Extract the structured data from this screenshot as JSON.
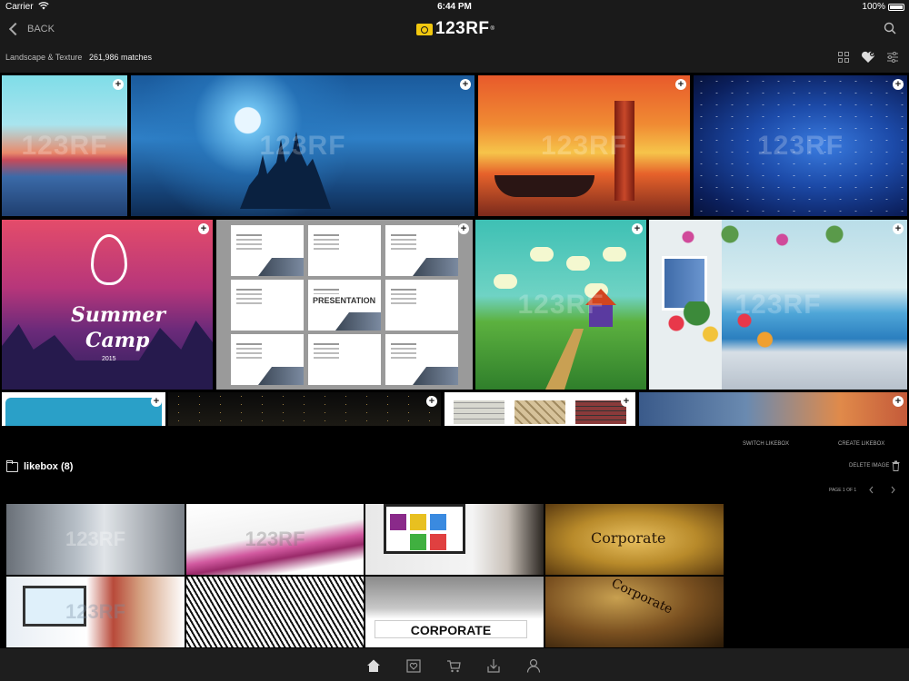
{
  "status_bar": {
    "carrier": "Carrier",
    "time": "6:44 PM",
    "battery": "100%"
  },
  "nav": {
    "back_label": "BACK",
    "logo_text": "123RF",
    "logo_mark": "®"
  },
  "filter": {
    "category": "Landscape & Texture",
    "matches": "261,986 matches"
  },
  "watermark": "123RF",
  "results": [
    {
      "name": "watercolor-lake"
    },
    {
      "name": "moonlit-castle"
    },
    {
      "name": "lighthouse-harbor"
    },
    {
      "name": "starry-galaxy"
    },
    {
      "name": "summer-camp",
      "line1": "Summer",
      "line2": "Camp",
      "year": "2015"
    },
    {
      "name": "presentation-templates",
      "title": "PRESENTATION"
    },
    {
      "name": "fairy-houses"
    },
    {
      "name": "seaside-flowers"
    },
    {
      "name": "blue-frame"
    },
    {
      "name": "night-city"
    },
    {
      "name": "brick-textures"
    },
    {
      "name": "sunset-sky"
    }
  ],
  "likebox": {
    "title": "likebox (8)",
    "switch_label": "SWITCH LIKEBOX",
    "create_label": "CREATE LIKEBOX",
    "delete_label": "DELETE IMAGE",
    "page_info": "PAGE 1 OF 1",
    "items": [
      {
        "name": "business-handshake"
      },
      {
        "name": "pink-swoosh"
      },
      {
        "name": "office-desk-monitor"
      },
      {
        "name": "corporate-grunge",
        "word": "Corporate"
      },
      {
        "name": "man-at-computer"
      },
      {
        "name": "wavy-lines"
      },
      {
        "name": "corporate-banner",
        "word": "CORPORATE"
      },
      {
        "name": "corporate-stamp",
        "word": "Corporate"
      }
    ]
  },
  "tabs": [
    {
      "name": "home",
      "icon": "home-icon",
      "active": true
    },
    {
      "name": "likebox",
      "icon": "heart-box-icon",
      "active": false
    },
    {
      "name": "cart",
      "icon": "cart-icon",
      "active": false
    },
    {
      "name": "downloads",
      "icon": "download-icon",
      "active": false
    },
    {
      "name": "account",
      "icon": "user-icon",
      "active": false
    }
  ],
  "colors": {
    "background": "#000000",
    "bar": "#1a1a1a",
    "logo_accent": "#f2c80f"
  }
}
